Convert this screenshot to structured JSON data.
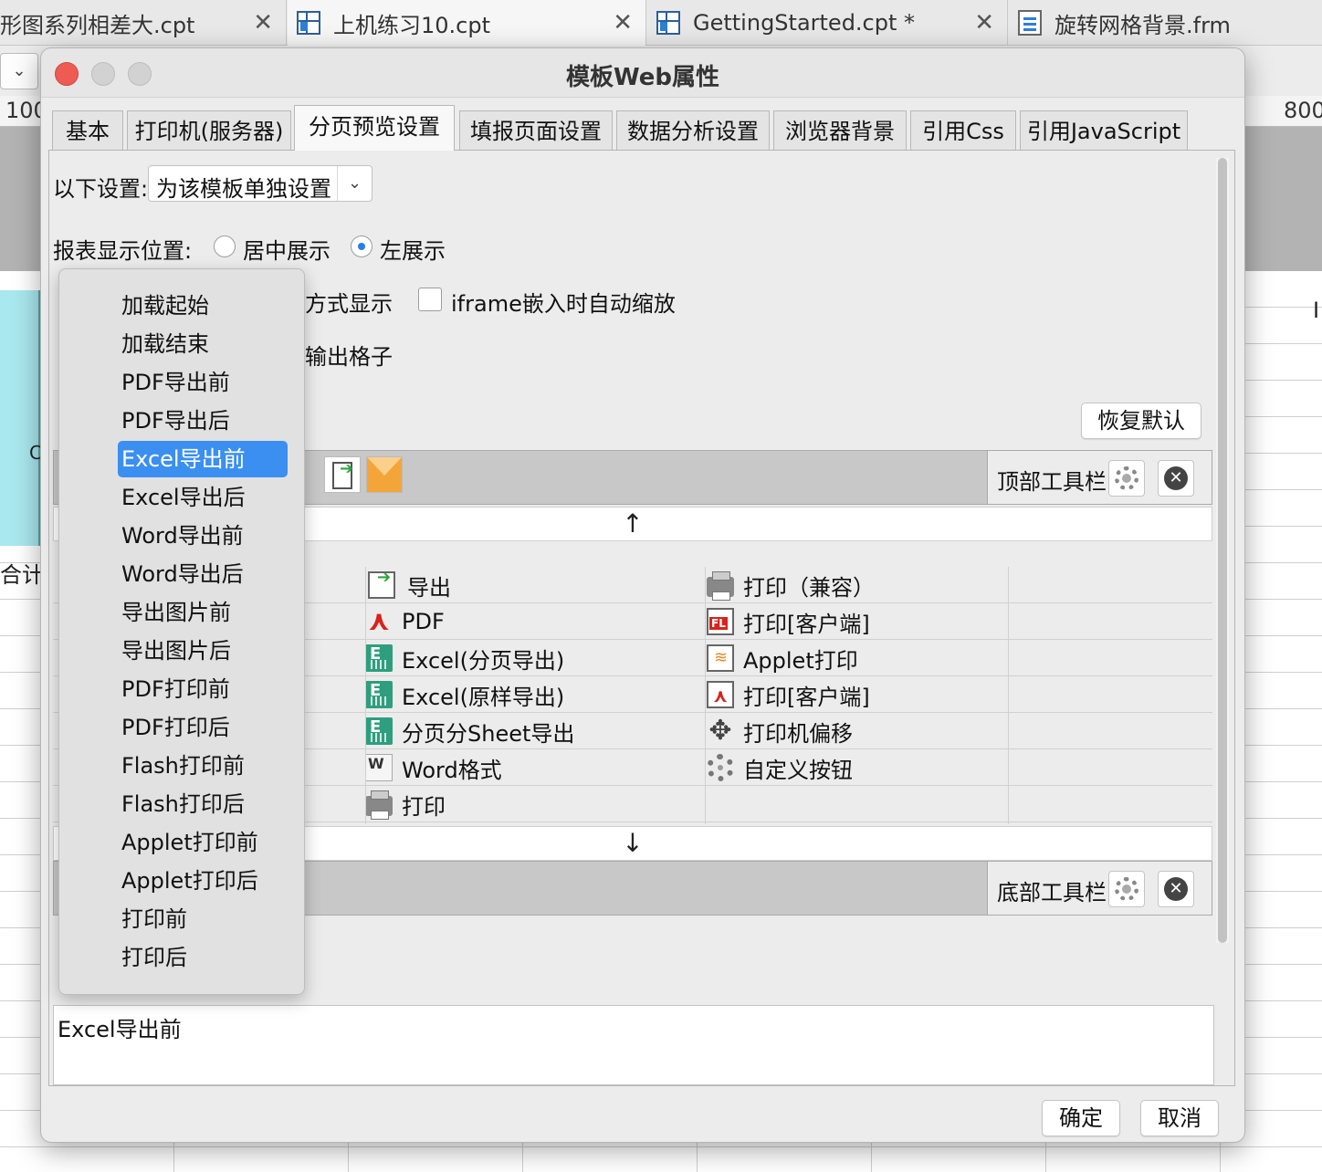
{
  "doc_tabs": [
    {
      "label": "形图系列相差大.cpt",
      "close": "✕"
    },
    {
      "label": "上机练习10.cpt",
      "close": "✕"
    },
    {
      "label": "GettingStarted.cpt *",
      "close": "✕"
    },
    {
      "label": "旋转网格背景.frm"
    }
  ],
  "ruler": {
    "left": "100",
    "right": "800"
  },
  "sheet_text": {
    "c": "C",
    "total": "合计",
    "row": "I"
  },
  "dialog": {
    "title": "模板Web属性",
    "tabs": [
      "基本",
      "打印机(服务器)",
      "分页预览设置",
      "填报页面设置",
      "数据分析设置",
      "浏览器背景",
      "引用Css",
      "引用JavaScript"
    ],
    "active_tab": "分页预览设置",
    "settings": {
      "scope_label": "以下设置:",
      "scope_value": "为该模板单独设置",
      "position_label": "报表显示位置:",
      "radio_center": "居中展示",
      "radio_left": "左展示",
      "display_mode_partial": "方式显示",
      "iframe_label": "iframe嵌入时自动缩放",
      "output_partial": "输出格子",
      "restore_default": "恢复默认"
    },
    "top_toolbar_label": "顶部工具栏",
    "bottom_toolbar_label": "底部工具栏",
    "buttons_col1": [
      "导出",
      "PDF",
      "Excel(分页导出)",
      "Excel(原样导出)",
      "分页分Sheet导出",
      "Word格式",
      "打印"
    ],
    "buttons_col2": [
      "打印（兼容）",
      "打印[客户端]",
      "Applet打印",
      "打印[客户端]",
      "打印机偏移",
      "自定义按钮"
    ],
    "event_options": [
      "加载起始",
      "加载结束",
      "PDF导出前",
      "PDF导出后",
      "Excel导出前",
      "Excel导出后",
      "Word导出前",
      "Word导出后",
      "导出图片前",
      "导出图片后",
      "PDF打印前",
      "PDF打印后",
      "Flash打印前",
      "Flash打印后",
      "Applet打印前",
      "Applet打印后",
      "打印前",
      "打印后"
    ],
    "selected_event": "Excel导出前",
    "description_text": "Excel导出前",
    "ok": "确定",
    "cancel": "取消"
  },
  "colors": {
    "accent": "#3b8ff0",
    "close_red": "#ee5b52",
    "excel_green": "#2e9e7e",
    "pdf_red": "#d6241d"
  }
}
